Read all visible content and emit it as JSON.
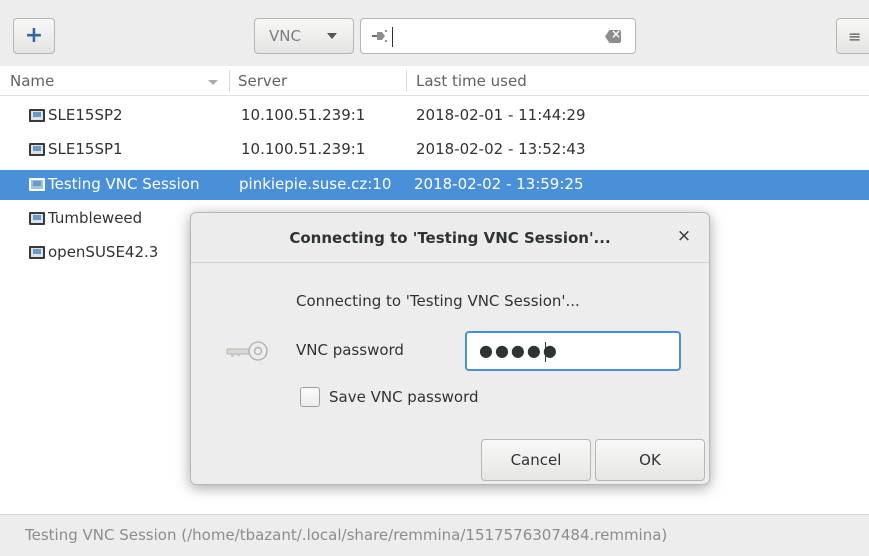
{
  "toolbar": {
    "protocol": "VNC",
    "search_value": ""
  },
  "columns": {
    "name": "Name",
    "server": "Server",
    "last_used": "Last time used"
  },
  "rows": [
    {
      "name": "SLE15SP2",
      "server": "10.100.51.239:1",
      "last": "2018-02-01 - 11:44:29"
    },
    {
      "name": "SLE15SP1",
      "server": "10.100.51.239:1",
      "last": "2018-02-02 - 13:52:43"
    },
    {
      "name": "Testing VNC Session",
      "server": "pinkiepie.suse.cz:10",
      "last": "2018-02-02 - 13:59:25",
      "selected": true
    },
    {
      "name": "Tumbleweed",
      "server": "",
      "last": ""
    },
    {
      "name": "openSUSE42.3",
      "server": "",
      "last": ""
    }
  ],
  "status": "Testing VNC Session (/home/tbazant/.local/share/remmina/1517576307484.remmina)",
  "dialog": {
    "title": "Connecting to 'Testing VNC Session'...",
    "close": "×",
    "message": "Connecting to 'Testing VNC Session'...",
    "password_label": "VNC password",
    "password_mask": "●●●●●",
    "save_label": "Save VNC password",
    "save_checked": false,
    "cancel": "Cancel",
    "ok": "OK"
  },
  "colors": {
    "selection": "#4a90d9",
    "accent": "#3465a4"
  }
}
